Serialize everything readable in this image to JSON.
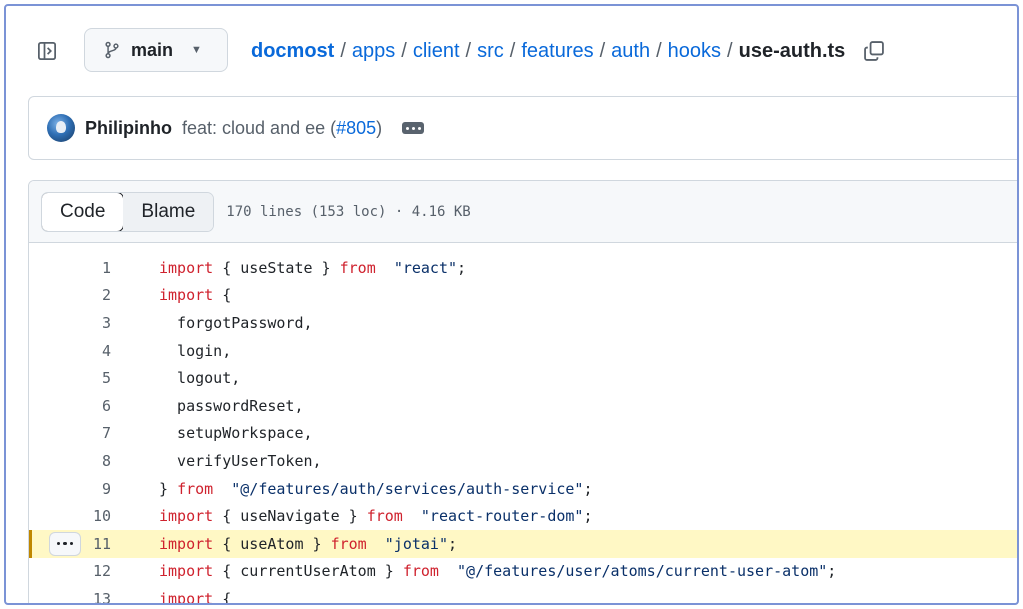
{
  "header": {
    "branch": "main",
    "breadcrumbs": [
      {
        "label": "docmost"
      },
      {
        "label": "apps"
      },
      {
        "label": "client"
      },
      {
        "label": "src"
      },
      {
        "label": "features"
      },
      {
        "label": "auth"
      },
      {
        "label": "hooks"
      }
    ],
    "separator": "/",
    "file_name": "use-auth.ts"
  },
  "commit": {
    "author": "Philipinho",
    "message": "feat: cloud and ee (",
    "pr_link": "#805",
    "message_end": ")"
  },
  "toolbar": {
    "code_tab": "Code",
    "blame_tab": "Blame",
    "file_meta": "170 lines (153 loc) · 4.16 KB"
  },
  "code": {
    "highlighted_line": 11,
    "lines": [
      {
        "n": "1",
        "parts": [
          [
            "kw",
            "import"
          ],
          [
            "",
            "{ useState } "
          ],
          [
            "kw",
            "from"
          ],
          [
            "",
            ""
          ],
          [
            "str",
            "\"react\""
          ],
          [
            "",
            ";"
          ]
        ]
      },
      {
        "n": "2",
        "parts": [
          [
            "kw",
            "import"
          ],
          [
            "",
            "{"
          ]
        ]
      },
      {
        "n": "3",
        "parts": [
          [
            "",
            "  forgotPassword,"
          ]
        ]
      },
      {
        "n": "4",
        "parts": [
          [
            "",
            "  login,"
          ]
        ]
      },
      {
        "n": "5",
        "parts": [
          [
            "",
            "  logout,"
          ]
        ]
      },
      {
        "n": "6",
        "parts": [
          [
            "",
            "  passwordReset,"
          ]
        ]
      },
      {
        "n": "7",
        "parts": [
          [
            "",
            "  setupWorkspace,"
          ]
        ]
      },
      {
        "n": "8",
        "parts": [
          [
            "",
            "  verifyUserToken,"
          ]
        ]
      },
      {
        "n": "9",
        "parts": [
          [
            "",
            "} "
          ],
          [
            "kw",
            "from"
          ],
          [
            "",
            ""
          ],
          [
            "str",
            "\"@/features/auth/services/auth-service\""
          ],
          [
            "",
            ";"
          ]
        ]
      },
      {
        "n": "10",
        "parts": [
          [
            "kw",
            "import"
          ],
          [
            "",
            "{ useNavigate } "
          ],
          [
            "kw",
            "from"
          ],
          [
            "",
            ""
          ],
          [
            "str",
            "\"react-router-dom\""
          ],
          [
            "",
            ";"
          ]
        ]
      },
      {
        "n": "11",
        "parts": [
          [
            "kw",
            "import"
          ],
          [
            "",
            "{ useAtom } "
          ],
          [
            "kw",
            "from"
          ],
          [
            "",
            ""
          ],
          [
            "str",
            "\"jotai\""
          ],
          [
            "",
            ";"
          ]
        ]
      },
      {
        "n": "12",
        "parts": [
          [
            "kw",
            "import"
          ],
          [
            "",
            "{ currentUserAtom } "
          ],
          [
            "kw",
            "from"
          ],
          [
            "",
            ""
          ],
          [
            "str",
            "\"@/features/user/atoms/current-user-atom\""
          ],
          [
            "",
            ";"
          ]
        ]
      },
      {
        "n": "13",
        "parts": [
          [
            "kw",
            "import"
          ],
          [
            "",
            "{"
          ]
        ]
      }
    ]
  },
  "colors": {
    "link": "#0969da",
    "keyword": "#cf222e",
    "string": "#0a3069",
    "highlight_bg": "#fff8c5",
    "highlight_bar": "#bf8700"
  },
  "icons": {
    "panel": "sidebar-panel-icon",
    "branch": "git-branch-icon",
    "caret": "triangle-down-icon",
    "copy": "copy-icon",
    "commit_menu": "ellipsis-icon",
    "line_menu": "kebab-horizontal-icon"
  }
}
